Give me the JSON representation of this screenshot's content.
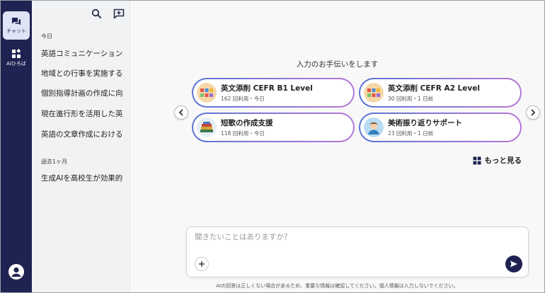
{
  "rail": {
    "chat_label": "チャット",
    "ai_label": "AIひろば"
  },
  "sidebar": {
    "groups": [
      {
        "label": "今日",
        "items": [
          "英語コミュニケーション",
          "地域との行事を実施する",
          "個別指導計画の作成に向",
          "現在進行形を活用した英",
          "英語の文章作成における"
        ]
      },
      {
        "label": "過去1ヶ月",
        "items": [
          "生成AIを高校生が効果的"
        ]
      }
    ]
  },
  "main": {
    "prompt_title": "入力のお手伝いをします",
    "cards": [
      {
        "title": "英文添削 CEFR B1 Level",
        "meta": "162 回利用・今日",
        "icon": "alphabet-blocks-icon"
      },
      {
        "title": "英文添削 CEFR A2 Level",
        "meta": "30 回利用・1 日前",
        "icon": "alphabet-blocks-icon"
      },
      {
        "title": "短歌の作成支援",
        "meta": "118 回利用・今日",
        "icon": "books-icon"
      },
      {
        "title": "美術振り返りサポート",
        "meta": "23 回利用・1 日前",
        "icon": "artist-icon"
      }
    ],
    "more_label": "もっと見る",
    "input": {
      "placeholder": "聞きたいことはありますか？",
      "value": ""
    },
    "disclaimer": "AIの回答は正しくない場合があるため、重要な情報は確認してください。個人情報は入力しないでください。"
  },
  "colors": {
    "rail_bg": "#1f2351",
    "card_border_start": "#5b74d6",
    "card_border_end": "#b478d8",
    "send_button": "#1f2351"
  }
}
